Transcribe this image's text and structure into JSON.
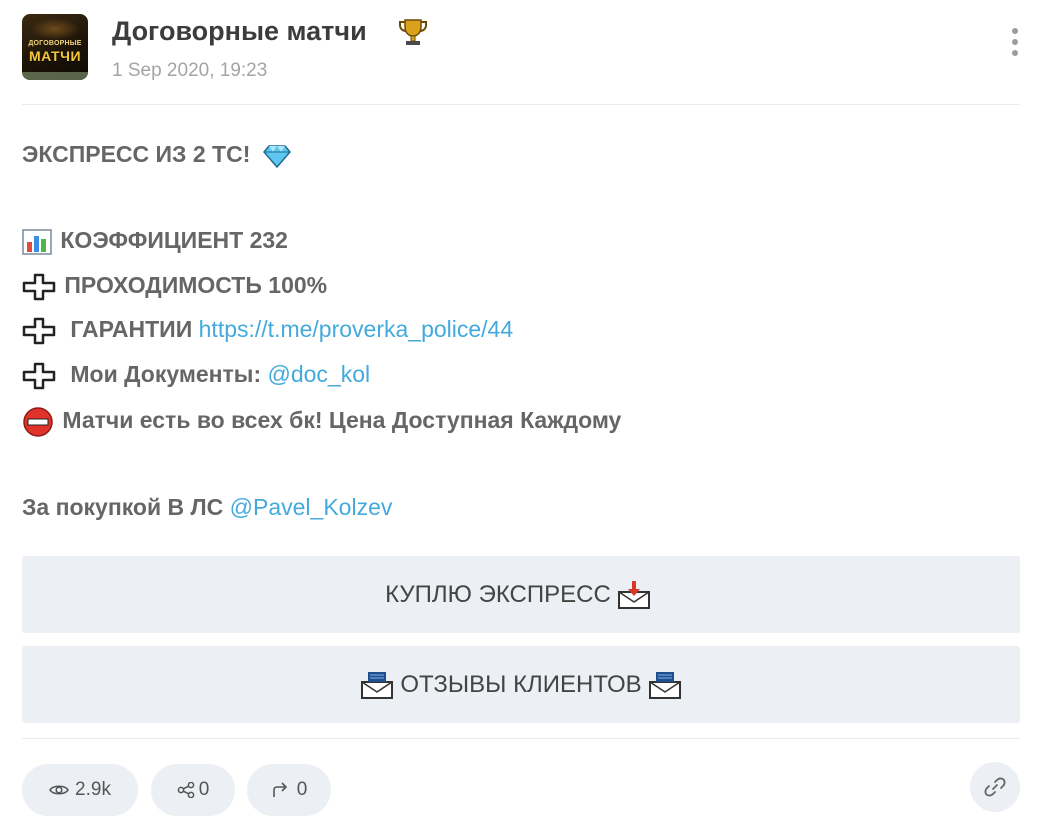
{
  "header": {
    "channel_name": "Договорные матчи",
    "date": "1 Sep 2020, 19:23",
    "avatar_text_top": "ДОГОВОРНЫЕ",
    "avatar_text_main": "МАТЧИ",
    "icons": {
      "title_badge": "trophy-icon",
      "menu": "more-vertical-icon"
    }
  },
  "post": {
    "headline": "ЭКСПРЕСС ИЗ 2 ТС!",
    "coef": "КОЭФФИЦИЕНТ 232",
    "pass_rate": "ПРОХОДИМОСТЬ 100%",
    "guarantee_label": "ГАРАНТИИ",
    "guarantee_link": "https://t.me/proverka_police/44",
    "docs_label": "Мои Документы:",
    "docs_link": "@doc_kol",
    "bk_text": "Матчи есть во всех бк! Цена Доступная Каждому",
    "purchase_label": "За покупкой В ЛС",
    "purchase_link": "@Pavel_Kolzev"
  },
  "buttons": {
    "buy_label": "КУПЛЮ ЭКСПРЕСС",
    "reviews_label": "ОТЗЫВЫ КЛИЕНТОВ"
  },
  "footer": {
    "views": "2.9k",
    "shares": "0",
    "forwards": "0"
  },
  "colors": {
    "text": "#666666",
    "link": "#44aadd",
    "button_bg": "#eceff3",
    "date": "#a4a4a4"
  }
}
